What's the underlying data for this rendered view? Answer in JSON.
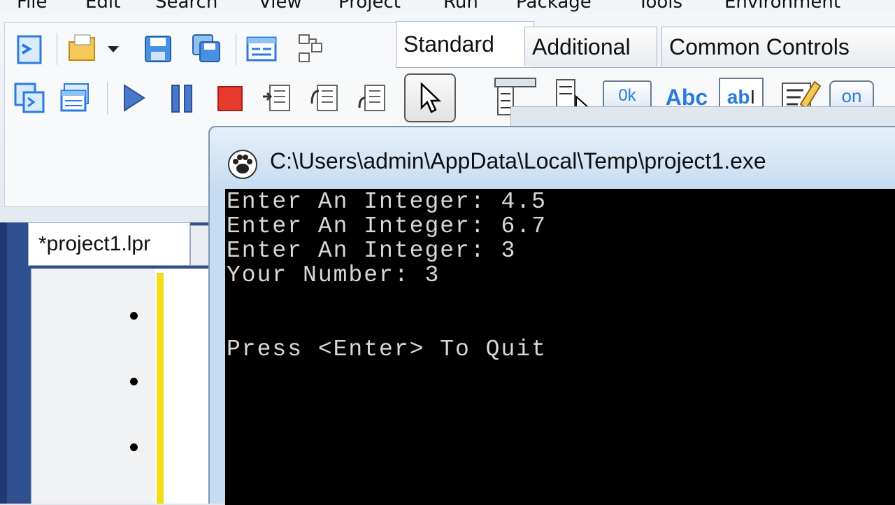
{
  "menu": {
    "items": [
      "File",
      "Edit",
      "Search",
      "View",
      "Project",
      "Run",
      "Package",
      "Tools",
      "Environment"
    ]
  },
  "component_tabs": [
    {
      "label": "Standard",
      "active": true
    },
    {
      "label": "Additional",
      "active": false
    },
    {
      "label": "Common Controls",
      "active": false
    }
  ],
  "palette": {
    "ok_label": "0k",
    "abc_label": "Abc",
    "edit_label": "ab",
    "toggle_label": "on"
  },
  "editor": {
    "tab_label": "*project1.lpr"
  },
  "console": {
    "title": "C:\\Users\\admin\\AppData\\Local\\Temp\\project1.exe",
    "lines": [
      "Enter An Integer: 4.5",
      "Enter An Integer: 6.7",
      "Enter An Integer: 3",
      "Your Number: 3",
      "",
      "",
      "Press <Enter> To Quit"
    ]
  },
  "colors": {
    "accent_blue": "#2a7be0",
    "stop_red": "#e83a2c",
    "run_blue": "#4a78c8",
    "console_bg": "#000000",
    "console_text": "#d8d8d8"
  }
}
